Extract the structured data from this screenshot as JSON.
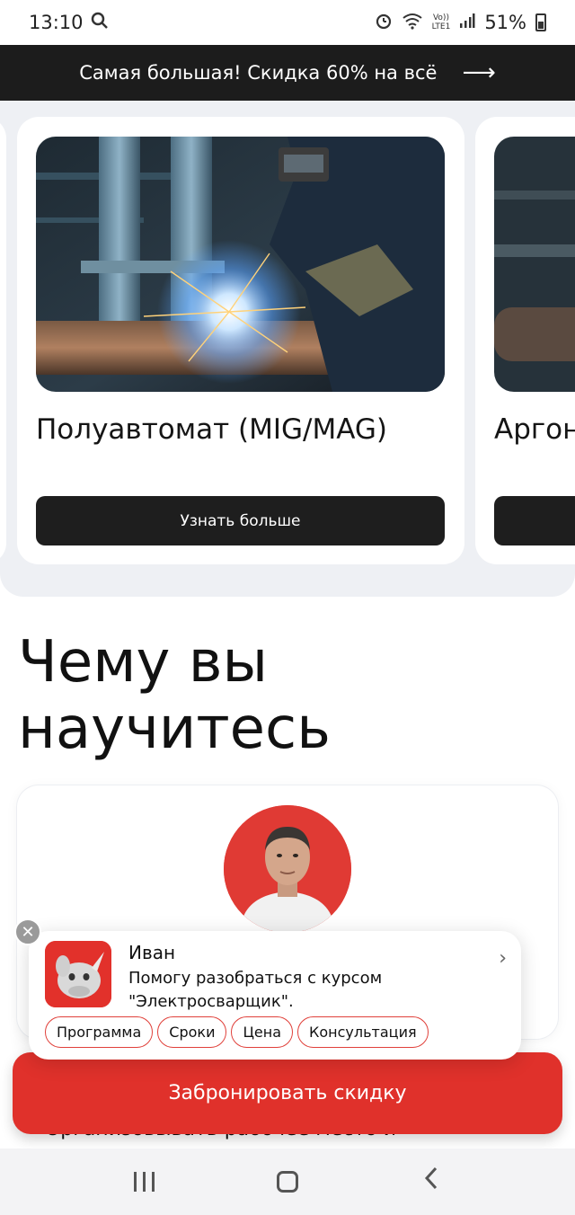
{
  "status_bar": {
    "time": "13:10",
    "battery": "51%",
    "icons": [
      "search-icon",
      "alarm-icon",
      "wifi-icon",
      "volte-icon",
      "signal-icon",
      "battery-icon"
    ],
    "volte_label_top": "Vo))",
    "volte_label_bottom": "LTE1"
  },
  "promo": {
    "text": "Самая большая! Скидка 60% на всё",
    "arrow": "⟶"
  },
  "carousel": {
    "cards": [
      {
        "title": "Полуавтомат (MIG/MAG)",
        "button": "Узнать больше"
      },
      {
        "title": "Аргон",
        "button": ""
      }
    ]
  },
  "section": {
    "heading_line1": "Чему вы",
    "heading_line2": "научитесь"
  },
  "list_peek": "Организовывать рабочее место и",
  "chat": {
    "name": "Иван",
    "message_line1": "Помогу разобраться с курсом",
    "message_line2": "\"Электросварщик\".",
    "close": "✕",
    "chevron": "›",
    "chips": [
      "Программа",
      "Сроки",
      "Цена",
      "Консультация"
    ]
  },
  "cta": {
    "label": "Забронировать скидку"
  },
  "colors": {
    "accent": "#e0312b",
    "dark": "#1c1c1c",
    "surface": "#eef0f4"
  }
}
